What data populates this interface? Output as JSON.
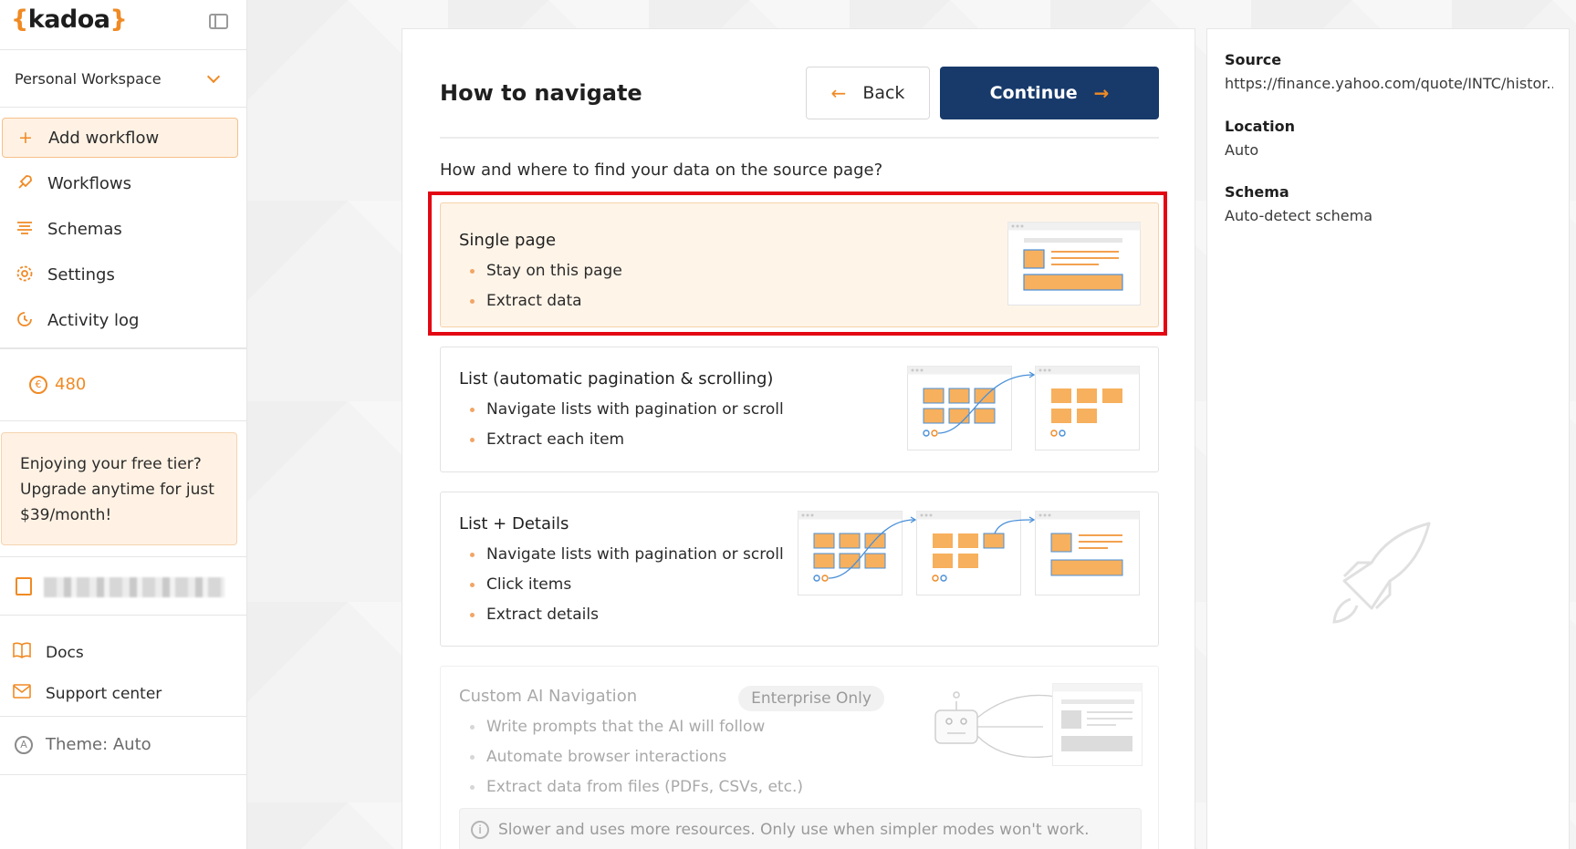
{
  "app": {
    "logo_brace_open": "{",
    "logo_text": "kadoa",
    "logo_brace_close": "}"
  },
  "sidebar": {
    "workspace": "Personal Workspace",
    "nav": [
      {
        "label": "Add workflow",
        "icon": "plus-icon",
        "active": true
      },
      {
        "label": "Workflows",
        "icon": "rocket-icon"
      },
      {
        "label": "Schemas",
        "icon": "list-icon"
      },
      {
        "label": "Settings",
        "icon": "gear-icon"
      },
      {
        "label": "Activity log",
        "icon": "clock-icon"
      }
    ],
    "credits": "480",
    "promo": "Enjoying your free tier? Upgrade anytime for just $39/month!",
    "docs": "Docs",
    "support": "Support center",
    "theme": "Theme: Auto"
  },
  "main": {
    "title": "How to navigate",
    "back_label": "Back",
    "continue_label": "Continue",
    "question": "How and where to find your data on the source page?",
    "options": [
      {
        "title": "Single page",
        "bullets": [
          "Stay on this page",
          "Extract data"
        ],
        "selected": true
      },
      {
        "title": "List (automatic pagination & scrolling)",
        "bullets": [
          "Navigate lists with pagination or scroll",
          "Extract each item"
        ]
      },
      {
        "title": "List + Details",
        "bullets": [
          "Navigate lists with pagination or scroll",
          "Click items",
          "Extract details"
        ]
      },
      {
        "title": "Custom AI Navigation",
        "badge": "Enterprise Only",
        "bullets": [
          "Write prompts that the AI will follow",
          "Automate browser interactions",
          "Extract data from files (PDFs, CSVs, etc.)"
        ],
        "note": "Slower and uses more resources. Only use when simpler modes won't work.",
        "disabled": true
      }
    ]
  },
  "right_panel": {
    "source_label": "Source",
    "source_value": "https://finance.yahoo.com/quote/INTC/histor...",
    "location_label": "Location",
    "location_value": "Auto",
    "schema_label": "Schema",
    "schema_value": "Auto-detect schema"
  },
  "colors": {
    "accent": "#f08a24",
    "primary_button": "#173a6b",
    "highlight": "#e30613"
  }
}
